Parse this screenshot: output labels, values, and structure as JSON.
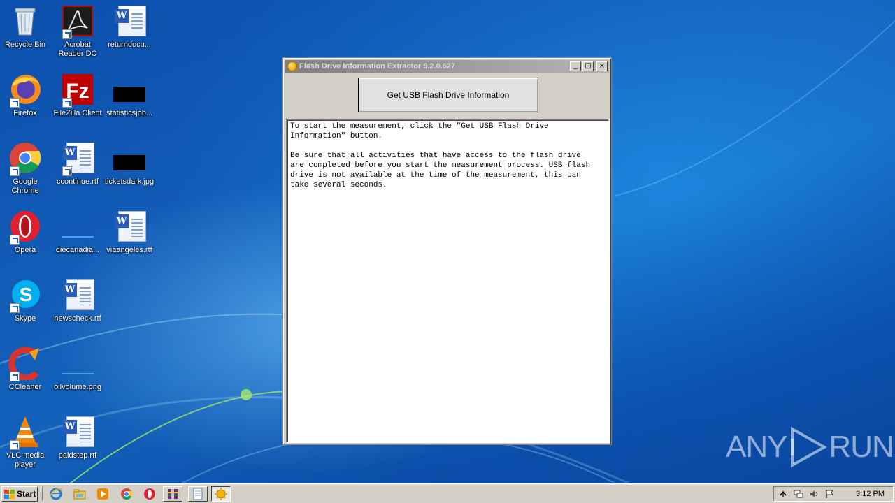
{
  "desktop": {
    "icons": [
      {
        "label": "Recycle Bin",
        "kind": "recycle-bin"
      },
      {
        "label": "Acrobat\nReader DC",
        "kind": "acrobat"
      },
      {
        "label": "returndocu...",
        "kind": "word"
      },
      {
        "label": "Firefox",
        "kind": "firefox"
      },
      {
        "label": "FileZilla Client",
        "kind": "filezilla"
      },
      {
        "label": "statisticsjob...",
        "kind": "image-black"
      },
      {
        "label": "Google\nChrome",
        "kind": "chrome"
      },
      {
        "label": "ccontinue.rtf",
        "kind": "word"
      },
      {
        "label": "ticketsdark.jpg",
        "kind": "image-black"
      },
      {
        "label": "Opera",
        "kind": "opera"
      },
      {
        "label": "diecanadia...",
        "kind": "image-blank"
      },
      {
        "label": "viaangeles.rtf",
        "kind": "word"
      },
      {
        "label": "Skype",
        "kind": "skype"
      },
      {
        "label": "newscheck.rtf",
        "kind": "word"
      },
      {
        "label": "CCleaner",
        "kind": "ccleaner"
      },
      {
        "label": "oilvolume.png",
        "kind": "image-blank"
      },
      {
        "label": "VLC media\nplayer",
        "kind": "vlc"
      },
      {
        "label": "paidstep.rtf",
        "kind": "word"
      }
    ]
  },
  "window": {
    "title": "Flash Drive Information Extractor 9.2.0.627",
    "minimize_glyph": "_",
    "maximize_glyph": "□",
    "close_glyph": "×",
    "button_label": "Get USB Flash Drive Information",
    "output_text": "To start the measurement, click the \"Get USB Flash Drive\nInformation\" button.\n\nBe sure that all activities that have access to the flash drive\nare completed before you start the measurement process. USB flash\ndrive is not available at the time of the measurement, this can\ntake several seconds."
  },
  "watermark": {
    "left": "ANY",
    "right": "RUN"
  },
  "taskbar": {
    "start_label": "Start",
    "quick_launch": [
      "ie-icon",
      "explorer-icon",
      "media-player-icon",
      "chrome-icon",
      "opera-icon"
    ],
    "apps": [
      "winrar-icon",
      "notepad-icon",
      "flash-extractor-icon"
    ],
    "tray_icons": [
      "show-hidden-icon",
      "network-icon",
      "volume-icon",
      "action-center-flag-icon"
    ],
    "clock": "3:12 PM"
  }
}
